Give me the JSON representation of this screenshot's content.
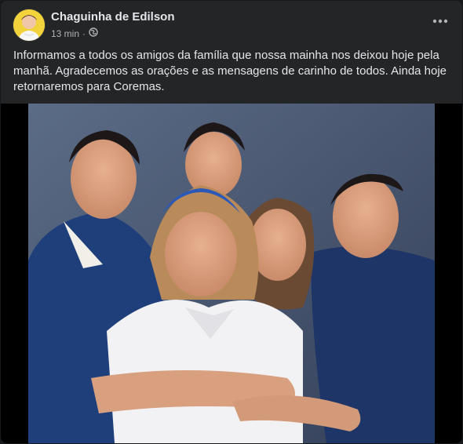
{
  "post": {
    "author": "Chaguinha de Edilson",
    "time": "13 min",
    "separator": "·",
    "privacy_icon": "globe-icon",
    "more_icon": "more-options-icon",
    "text": "Informamos a todos os amigos da família que nossa mainha nos deixou hoje pela manhã. Agradecemos as orações e as mensagens de carinho de todos. Ainda hoje retornaremos para Coremas.",
    "photo": {
      "description_icon": "family-photo"
    }
  },
  "colors": {
    "background": "#18191a",
    "card": "#242526",
    "primary_text": "#e4e6eb",
    "secondary_text": "#b0b3b8",
    "avatar_bg": "#f2d33b"
  }
}
